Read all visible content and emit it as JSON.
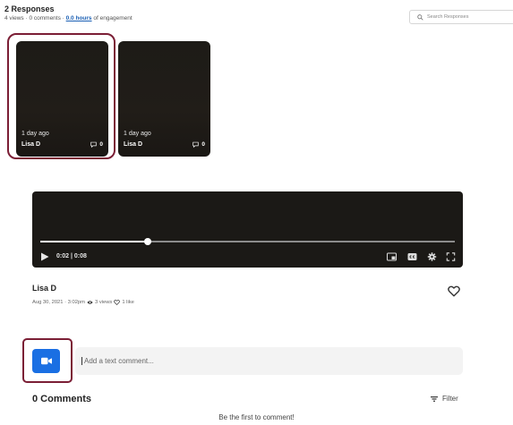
{
  "header": {
    "responses_title": "2 Responses",
    "stats_prefix": "4 views · 0 comments · ",
    "engagement_link": "0.0 hours",
    "stats_suffix": " of engagement"
  },
  "search": {
    "placeholder": "Search Responses",
    "icon": "search-icon"
  },
  "cards": [
    {
      "time_ago": "1 day ago",
      "author": "Lisa D",
      "comment_count": "0"
    },
    {
      "time_ago": "1 day ago",
      "author": "Lisa D",
      "comment_count": "0"
    }
  ],
  "player": {
    "time_display": "0:02 | 0:08",
    "progress_fraction": 0.26,
    "controls": [
      "play-icon",
      "picture-in-picture-icon",
      "captions-icon",
      "settings-icon",
      "fullscreen-icon"
    ]
  },
  "post": {
    "author": "Lisa D",
    "date": "Aug 30, 2021 · 3:02pm",
    "views": "3 views",
    "likes": "1 like"
  },
  "comment": {
    "placeholder": "Add a text comment...",
    "count_label": "0 Comments",
    "filter_label": "Filter",
    "empty_message": "Be the first to comment!"
  },
  "colors": {
    "accent_blue": "#1a6fe3",
    "highlight_border": "#7b1e35",
    "link_blue": "#1a5fb4",
    "video_bg": "#1b1916"
  }
}
